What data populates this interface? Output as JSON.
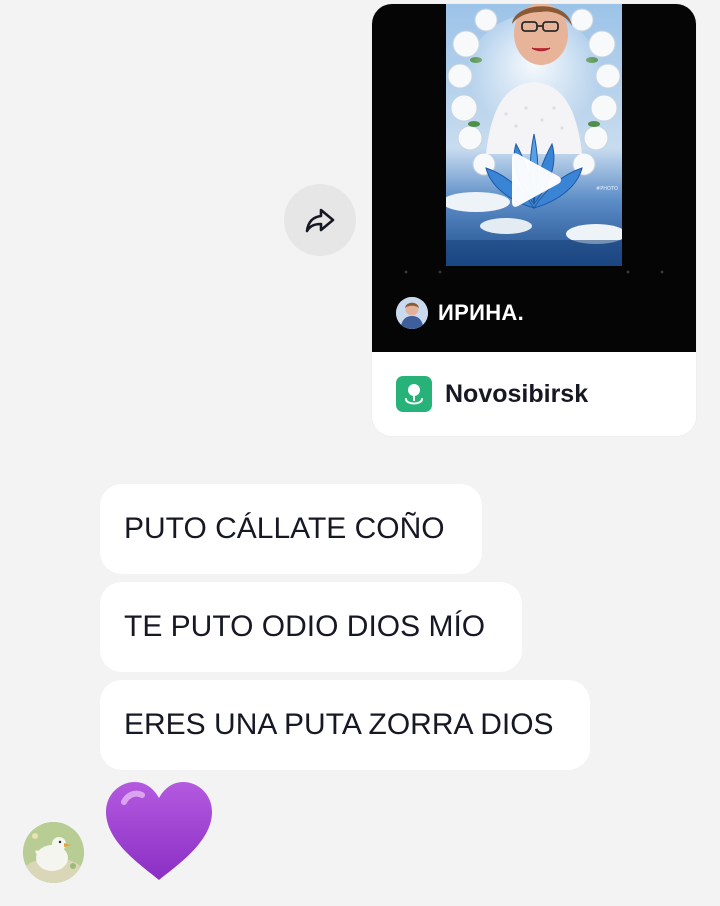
{
  "chat": {
    "shared_video": {
      "author_name": "ИРИНА.",
      "location": "Novosibirsk",
      "thumbnail_icon": "play-icon",
      "location_icon": "location-pin-icon"
    },
    "share_button_icon": "share-arrow-icon",
    "messages": [
      {
        "text": "PUTO CÁLLATE COÑO"
      },
      {
        "text": "TE PUTO ODIO DIOS MÍO"
      },
      {
        "text": "ERES UNA PUTA ZORRA DIOS"
      }
    ],
    "emoji_message": {
      "icon": "purple-heart-icon"
    },
    "sender_avatar_icon": "avatar"
  },
  "colors": {
    "background": "#f3f3f3",
    "bubble": "#ffffff",
    "text": "#161823",
    "location_badge": "#27b27a",
    "heart": "#9b3fd1"
  }
}
